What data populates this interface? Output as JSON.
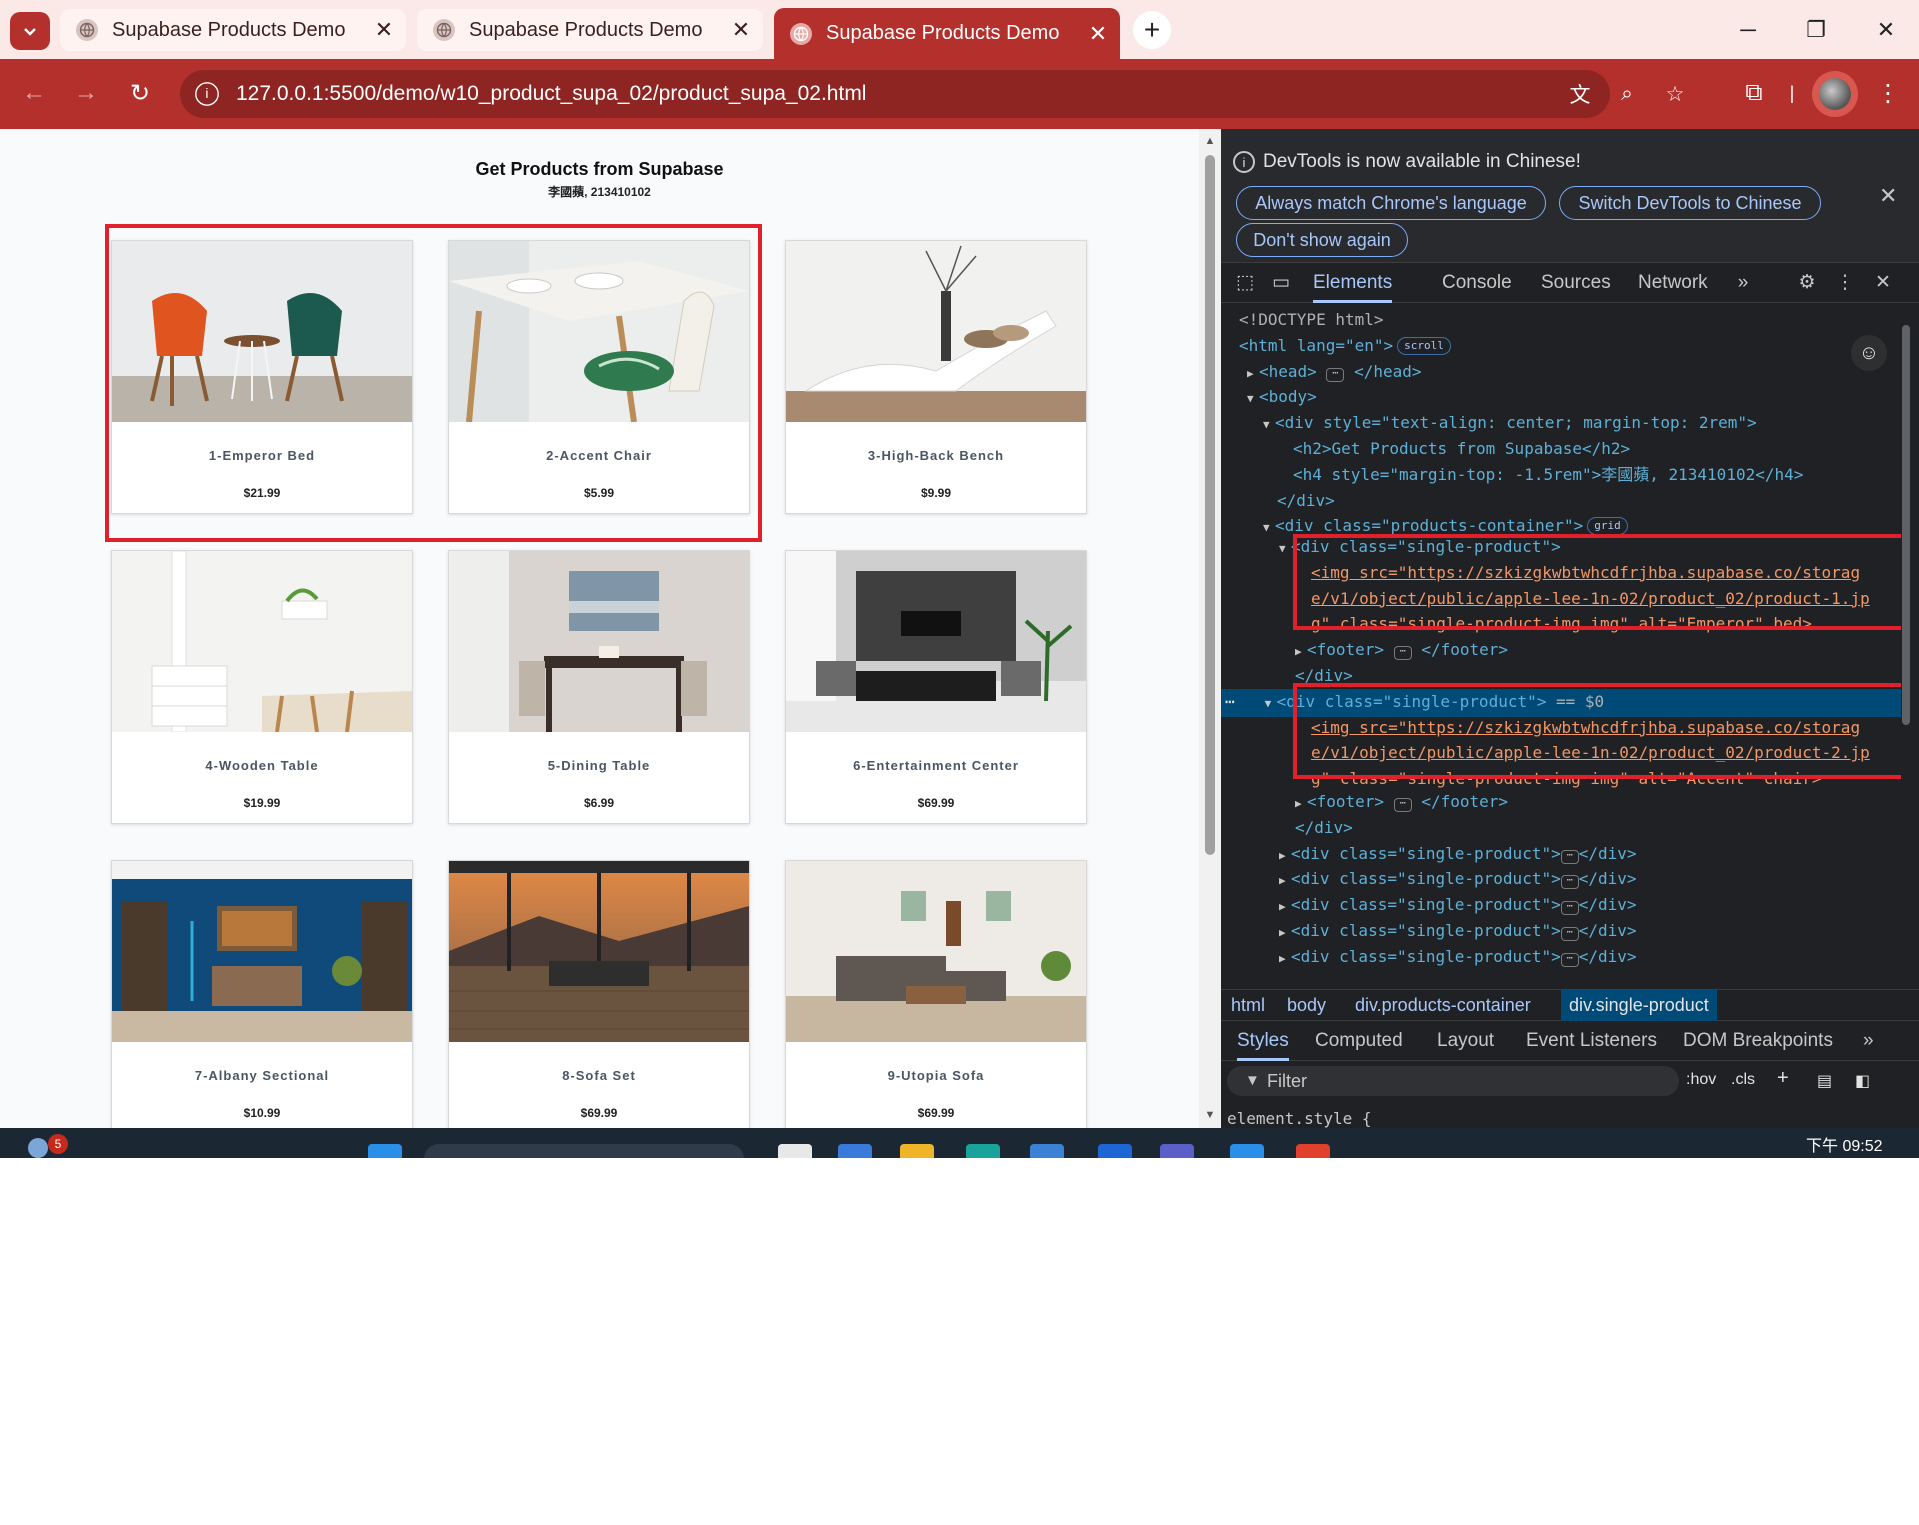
{
  "browser": {
    "tabs": [
      {
        "title": "Supabase Products Demo",
        "active": false
      },
      {
        "title": "Supabase Products Demo",
        "active": false
      },
      {
        "title": "Supabase Products Demo",
        "active": true
      }
    ],
    "new_tab_label": "+",
    "url": "127.0.0.1:5500/demo/w10_product_supa_02/product_supa_02.html"
  },
  "page": {
    "heading": "Get Products from Supabase",
    "subheading": "李國蘋, 213410102",
    "products": [
      {
        "name": "1-Emperor Bed",
        "price": "$21.99"
      },
      {
        "name": "2-Accent Chair",
        "price": "$5.99"
      },
      {
        "name": "3-High-Back Bench",
        "price": "$9.99"
      },
      {
        "name": "4-Wooden Table",
        "price": "$19.99"
      },
      {
        "name": "5-Dining Table",
        "price": "$6.99"
      },
      {
        "name": "6-Entertainment Center",
        "price": "$69.99"
      },
      {
        "name": "7-Albany Sectional",
        "price": "$10.99"
      },
      {
        "name": "8-Sofa Set",
        "price": "$69.99"
      },
      {
        "name": "9-Utopia Sofa",
        "price": "$69.99"
      }
    ]
  },
  "devtools": {
    "infobar": {
      "message": "DevTools is now available in Chinese!",
      "buttons": [
        "Always match Chrome's language",
        "Switch DevTools to Chinese",
        "Don't show again"
      ]
    },
    "tabs": [
      "Elements",
      "Console",
      "Sources",
      "Network"
    ],
    "active_tab": "Elements",
    "dom": {
      "doctype": "<!DOCTYPE html>",
      "html_open": "<html lang=\"en\">",
      "scroll_badge": "scroll",
      "grid_badge": "grid",
      "head": "<head>",
      "head_close": "</head>",
      "body": "<body>",
      "div_center": "<div style=\"text-align: center; margin-top: 2rem\">",
      "h2": "<h2>Get Products from Supabase</h2>",
      "h4": "<h4 style=\"margin-top: -1.5rem\">李國蘋, 213410102</h4>",
      "div_close": "</div>",
      "products_container": "<div class=\"products-container\">",
      "single_product": "<div class=\"single-product\">",
      "img1_a": "<img src=\"https://szkizgkwbtwhcdfrjhba.supabase.co/storag",
      "img1_b": "e/v1/object/public/apple-lee-1n-02/product_02/product-1.jp",
      "img1_c": "g\" class=\"single-product-img img\" alt=\"Emperor\" bed>",
      "footer": "<footer>",
      "footer_close": "</footer>",
      "selected_marker": "== $0",
      "img2_a": "<img src=\"https://szkizgkwbtwhcdfrjhba.supabase.co/storag",
      "img2_b": "e/v1/object/public/apple-lee-1n-02/product_02/product-2.jp",
      "img2_c": "g\" class=\"single-product-img img\" alt=\"Accent\" chair>",
      "collapsed_product": "<div class=\"single-product\">",
      "collapsed_close": "</div>"
    },
    "breadcrumbs": [
      "html",
      "body",
      "div.products-container",
      "div.single-product"
    ],
    "subtabs": [
      "Styles",
      "Computed",
      "Layout",
      "Event Listeners",
      "DOM Breakpoints"
    ],
    "filter_placeholder": "Filter",
    "hov_label": ":hov",
    "cls_label": ".cls",
    "element_style": "element.style {"
  },
  "taskbar": {
    "notification_count": "5",
    "time": "下午 09:52"
  }
}
